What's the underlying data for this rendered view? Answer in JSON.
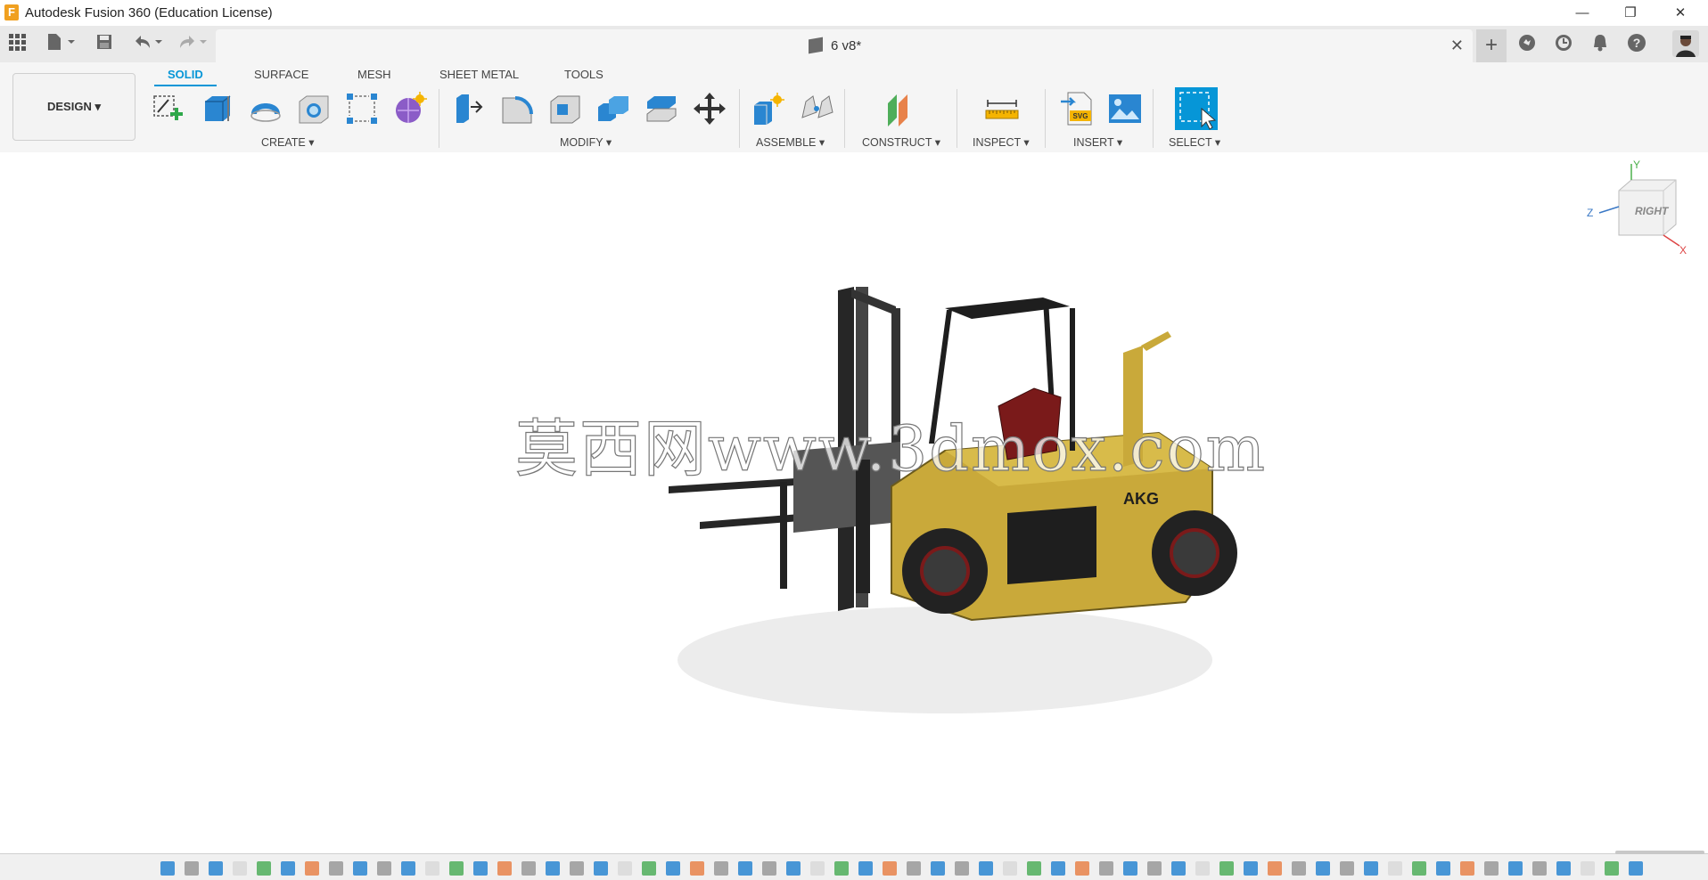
{
  "window": {
    "title": "Autodesk Fusion 360 (Education License)",
    "app_icon_letter": "F",
    "controls": {
      "minimize": "—",
      "restore": "❐",
      "close": "✕"
    }
  },
  "quick_access": {
    "grid_icon": "grid-icon",
    "file_icon": "file-icon",
    "save_icon": "save-icon",
    "undo_icon": "undo-icon",
    "redo_icon": "redo-icon"
  },
  "document": {
    "tab_name": "6 v8*",
    "close": "✕",
    "new_tab": "+"
  },
  "toolbar": {
    "workspace_label": "DESIGN ▾",
    "tabs": [
      "SOLID",
      "SURFACE",
      "MESH",
      "SHEET METAL",
      "TOOLS"
    ],
    "groups": [
      {
        "label": "CREATE ▾"
      },
      {
        "label": "MODIFY ▾"
      },
      {
        "label": "ASSEMBLE ▾"
      },
      {
        "label": "CONSTRUCT ▾"
      },
      {
        "label": "INSPECT ▾"
      },
      {
        "label": "INSERT ▾"
      },
      {
        "label": "SELECT ▾"
      }
    ]
  },
  "viewcube": {
    "face_label": "RIGHT",
    "axis_y": "Y",
    "axis_z": "Z",
    "axis_x": "X"
  },
  "model": {
    "brand_label": "AKG"
  },
  "watermark": "莫西网www.3dmox.com",
  "colors": {
    "accent": "#0696d7",
    "forklift_body": "#c9a93a",
    "forklift_dark": "#1e1e1e",
    "seat": "#7a1a1a"
  }
}
